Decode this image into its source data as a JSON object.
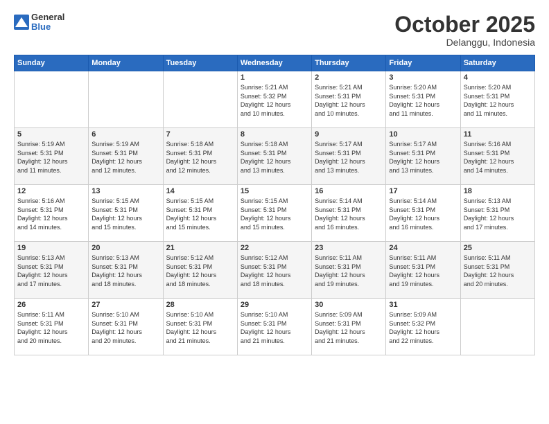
{
  "header": {
    "logo": {
      "general": "General",
      "blue": "Blue"
    },
    "title": "October 2025",
    "location": "Delanggu, Indonesia"
  },
  "days_of_week": [
    "Sunday",
    "Monday",
    "Tuesday",
    "Wednesday",
    "Thursday",
    "Friday",
    "Saturday"
  ],
  "weeks": [
    [
      {
        "day": "",
        "info": ""
      },
      {
        "day": "",
        "info": ""
      },
      {
        "day": "",
        "info": ""
      },
      {
        "day": "1",
        "info": "Sunrise: 5:21 AM\nSunset: 5:32 PM\nDaylight: 12 hours\nand 10 minutes."
      },
      {
        "day": "2",
        "info": "Sunrise: 5:21 AM\nSunset: 5:31 PM\nDaylight: 12 hours\nand 10 minutes."
      },
      {
        "day": "3",
        "info": "Sunrise: 5:20 AM\nSunset: 5:31 PM\nDaylight: 12 hours\nand 11 minutes."
      },
      {
        "day": "4",
        "info": "Sunrise: 5:20 AM\nSunset: 5:31 PM\nDaylight: 12 hours\nand 11 minutes."
      }
    ],
    [
      {
        "day": "5",
        "info": "Sunrise: 5:19 AM\nSunset: 5:31 PM\nDaylight: 12 hours\nand 11 minutes."
      },
      {
        "day": "6",
        "info": "Sunrise: 5:19 AM\nSunset: 5:31 PM\nDaylight: 12 hours\nand 12 minutes."
      },
      {
        "day": "7",
        "info": "Sunrise: 5:18 AM\nSunset: 5:31 PM\nDaylight: 12 hours\nand 12 minutes."
      },
      {
        "day": "8",
        "info": "Sunrise: 5:18 AM\nSunset: 5:31 PM\nDaylight: 12 hours\nand 13 minutes."
      },
      {
        "day": "9",
        "info": "Sunrise: 5:17 AM\nSunset: 5:31 PM\nDaylight: 12 hours\nand 13 minutes."
      },
      {
        "day": "10",
        "info": "Sunrise: 5:17 AM\nSunset: 5:31 PM\nDaylight: 12 hours\nand 13 minutes."
      },
      {
        "day": "11",
        "info": "Sunrise: 5:16 AM\nSunset: 5:31 PM\nDaylight: 12 hours\nand 14 minutes."
      }
    ],
    [
      {
        "day": "12",
        "info": "Sunrise: 5:16 AM\nSunset: 5:31 PM\nDaylight: 12 hours\nand 14 minutes."
      },
      {
        "day": "13",
        "info": "Sunrise: 5:15 AM\nSunset: 5:31 PM\nDaylight: 12 hours\nand 15 minutes."
      },
      {
        "day": "14",
        "info": "Sunrise: 5:15 AM\nSunset: 5:31 PM\nDaylight: 12 hours\nand 15 minutes."
      },
      {
        "day": "15",
        "info": "Sunrise: 5:15 AM\nSunset: 5:31 PM\nDaylight: 12 hours\nand 15 minutes."
      },
      {
        "day": "16",
        "info": "Sunrise: 5:14 AM\nSunset: 5:31 PM\nDaylight: 12 hours\nand 16 minutes."
      },
      {
        "day": "17",
        "info": "Sunrise: 5:14 AM\nSunset: 5:31 PM\nDaylight: 12 hours\nand 16 minutes."
      },
      {
        "day": "18",
        "info": "Sunrise: 5:13 AM\nSunset: 5:31 PM\nDaylight: 12 hours\nand 17 minutes."
      }
    ],
    [
      {
        "day": "19",
        "info": "Sunrise: 5:13 AM\nSunset: 5:31 PM\nDaylight: 12 hours\nand 17 minutes."
      },
      {
        "day": "20",
        "info": "Sunrise: 5:13 AM\nSunset: 5:31 PM\nDaylight: 12 hours\nand 18 minutes."
      },
      {
        "day": "21",
        "info": "Sunrise: 5:12 AM\nSunset: 5:31 PM\nDaylight: 12 hours\nand 18 minutes."
      },
      {
        "day": "22",
        "info": "Sunrise: 5:12 AM\nSunset: 5:31 PM\nDaylight: 12 hours\nand 18 minutes."
      },
      {
        "day": "23",
        "info": "Sunrise: 5:11 AM\nSunset: 5:31 PM\nDaylight: 12 hours\nand 19 minutes."
      },
      {
        "day": "24",
        "info": "Sunrise: 5:11 AM\nSunset: 5:31 PM\nDaylight: 12 hours\nand 19 minutes."
      },
      {
        "day": "25",
        "info": "Sunrise: 5:11 AM\nSunset: 5:31 PM\nDaylight: 12 hours\nand 20 minutes."
      }
    ],
    [
      {
        "day": "26",
        "info": "Sunrise: 5:11 AM\nSunset: 5:31 PM\nDaylight: 12 hours\nand 20 minutes."
      },
      {
        "day": "27",
        "info": "Sunrise: 5:10 AM\nSunset: 5:31 PM\nDaylight: 12 hours\nand 20 minutes."
      },
      {
        "day": "28",
        "info": "Sunrise: 5:10 AM\nSunset: 5:31 PM\nDaylight: 12 hours\nand 21 minutes."
      },
      {
        "day": "29",
        "info": "Sunrise: 5:10 AM\nSunset: 5:31 PM\nDaylight: 12 hours\nand 21 minutes."
      },
      {
        "day": "30",
        "info": "Sunrise: 5:09 AM\nSunset: 5:31 PM\nDaylight: 12 hours\nand 21 minutes."
      },
      {
        "day": "31",
        "info": "Sunrise: 5:09 AM\nSunset: 5:32 PM\nDaylight: 12 hours\nand 22 minutes."
      },
      {
        "day": "",
        "info": ""
      }
    ]
  ]
}
